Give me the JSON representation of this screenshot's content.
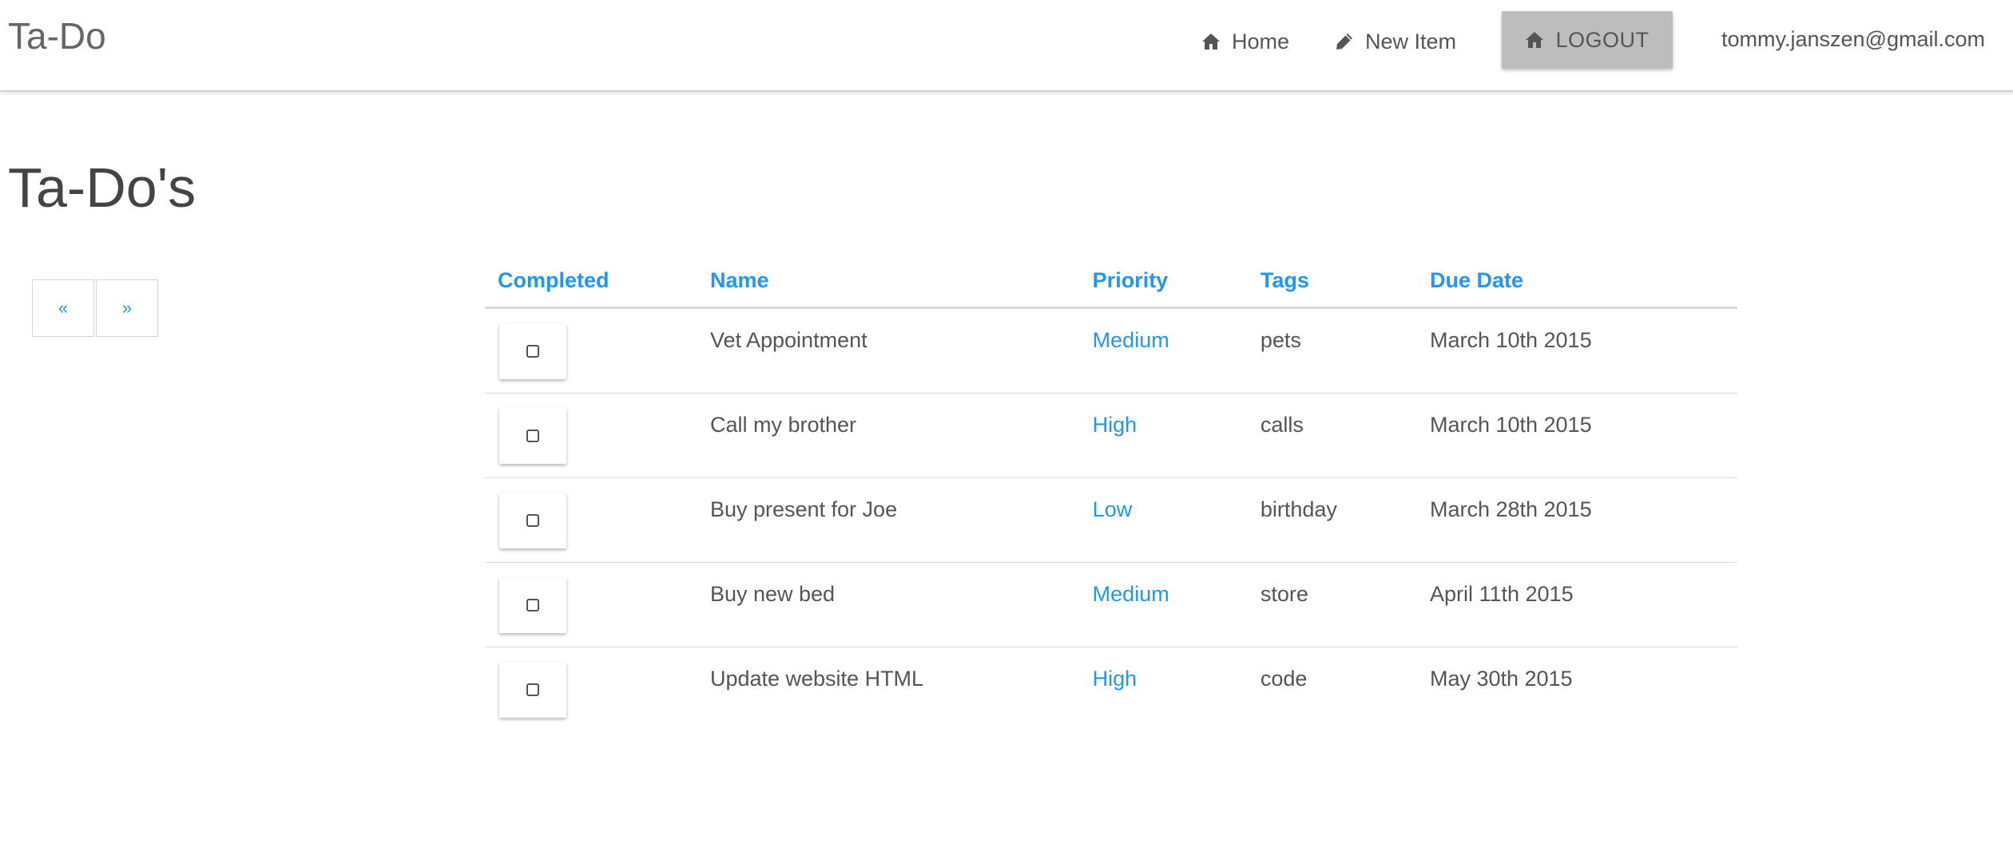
{
  "navbar": {
    "brand": "Ta-Do",
    "links": [
      {
        "label": "Home",
        "icon": "home-icon"
      },
      {
        "label": "New Item",
        "icon": "pencil-icon"
      }
    ],
    "logout": {
      "label": "LOGOUT",
      "icon": "home-icon"
    },
    "user_email": "tommy.janszen@gmail.com"
  },
  "page": {
    "title": "Ta-Do's"
  },
  "pager": {
    "prev": "«",
    "next": "»"
  },
  "table": {
    "headers": [
      "Completed",
      "Name",
      "Priority",
      "Tags",
      "Due Date"
    ],
    "rows": [
      {
        "completed": false,
        "name": "Vet Appointment",
        "priority": "Medium",
        "tags": "pets",
        "due_date": "March 10th 2015"
      },
      {
        "completed": false,
        "name": "Call my brother",
        "priority": "High",
        "tags": "calls",
        "due_date": "March 10th 2015"
      },
      {
        "completed": false,
        "name": "Buy present for Joe",
        "priority": "Low",
        "tags": "birthday",
        "due_date": "March 28th 2015"
      },
      {
        "completed": false,
        "name": "Buy new bed",
        "priority": "Medium",
        "tags": "store",
        "due_date": "April 11th 2015"
      },
      {
        "completed": false,
        "name": "Update website HTML",
        "priority": "High",
        "tags": "code",
        "due_date": "May 30th 2015"
      }
    ]
  },
  "colors": {
    "accent": "#2196f3",
    "logout_bg": "#bdbdbd",
    "text": "#555555"
  }
}
